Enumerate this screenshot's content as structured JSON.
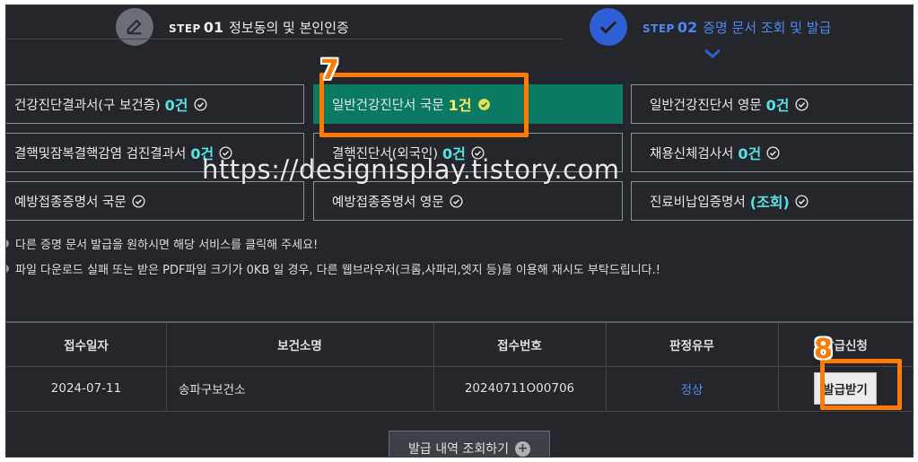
{
  "steps": [
    {
      "small": "STEP",
      "num": "01",
      "title": "정보동의 및 본인인증",
      "icon": "pencil-icon"
    },
    {
      "small": "STEP",
      "num": "02",
      "title": "증명 문서 조회 및 발급",
      "icon": "check-icon"
    }
  ],
  "certs": [
    {
      "label": "건강진단결과서(구 보건증)",
      "count": "0건"
    },
    {
      "label": "일반건강진단서 국문",
      "count": "1건"
    },
    {
      "label": "일반건강진단서 영문",
      "count": "0건"
    },
    {
      "label": "결핵및잠복결핵감염 검진결과서",
      "count": "0건"
    },
    {
      "label": "결핵진단서(외국인)",
      "count": "0건"
    },
    {
      "label": "채용신체검사서",
      "count": "0건"
    },
    {
      "label": "예방접종증명서 국문",
      "count": ""
    },
    {
      "label": "예방접종증명서 영문",
      "count": ""
    },
    {
      "label": "진료비납입증명서",
      "count": "(조회)"
    }
  ],
  "notices": [
    "다른 증명 문서 발급을 원하시면 해당 서비스를 클릭해 주세요!",
    "파일 다운로드 실패 또는 받은 PDF파일 크기가 0KB 일 경우, 다른 웹브라우저(크롬,사파리,엣지 등)를 이용해 재시도 부탁드립니다.!"
  ],
  "table": {
    "headers": [
      "접수일자",
      "보건소명",
      "접수번호",
      "판정유무",
      "발급신청"
    ],
    "row": {
      "date": "2024-07-11",
      "center": "송파구보건소",
      "receipt": "20240711O00706",
      "result": "정상",
      "button": "발급받기"
    }
  },
  "bottom_button": "발급 내역 조회하기",
  "annotations": {
    "marker7": "7",
    "marker8": "8"
  },
  "watermark": "https://designisplay.tistory.com",
  "colors": {
    "accent": "#0a7a63",
    "highlight": "#ff7a00",
    "count": "#54e3e3",
    "step_active": "#2f5fd4"
  }
}
